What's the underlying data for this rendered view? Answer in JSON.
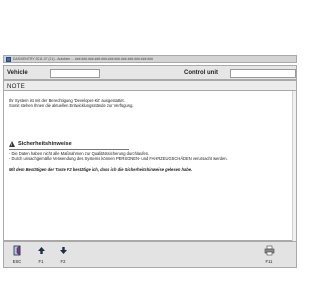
{
  "window": {
    "title": "DAS/XENTRY 2011.07 (21) - Autofahr ... ###.###.###.###.###.###.###.###.###.###.###.###"
  },
  "header": {
    "vehicle_label": "Vehicle",
    "vehicle_value": "",
    "control_unit_label": "Control unit",
    "control_unit_value": ""
  },
  "note": {
    "title": "NOTE"
  },
  "content": {
    "line1": "Ihr System ist mit der Berechtigung 'Developer-Kit' ausgestattet.",
    "line2": "Somit stehen Ihnen die aktuellen Entwicklungsstände zur Verfügung.",
    "warning_title": "Sicherheitshinweise",
    "bullet1": "- Die Daten haben nicht alle Maßnahmen zur Qualitätssicherung durchlaufen.",
    "bullet2": "- Durch unsachgemäße Verwendung des Systems können PERSONEN- und FAHRZEUGSCHÄDEN verursacht werden.",
    "confirm": "Mit dem Bestätigen der Taste F2 bestätige ich, dass ich die Sicherheitshinweise gelesen habe."
  },
  "toolbar": {
    "buttons": [
      {
        "key": "ESC",
        "icon": "exit-door-icon"
      },
      {
        "key": "F1",
        "icon": "arrow-up-icon"
      },
      {
        "key": "F2",
        "icon": "arrow-down-icon"
      },
      {
        "key": "F11",
        "icon": "printer-icon"
      }
    ]
  }
}
